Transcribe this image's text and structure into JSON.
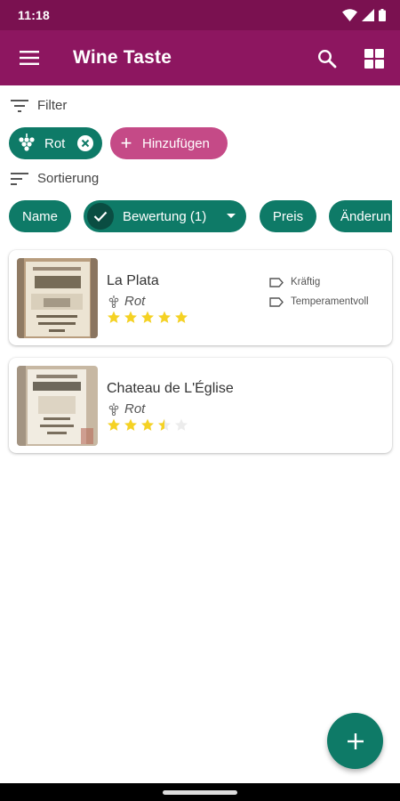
{
  "status_bar": {
    "time": "11:18"
  },
  "app_bar": {
    "title": "Wine Taste"
  },
  "filter": {
    "label": "Filter",
    "chips": [
      {
        "label": "Rot",
        "removable": true
      },
      {
        "label": "Hinzufügen"
      }
    ]
  },
  "sort": {
    "label": "Sortierung",
    "chips": [
      {
        "label": "Name"
      },
      {
        "label": "Bewertung (1)",
        "selected": true
      },
      {
        "label": "Preis"
      },
      {
        "label": "Änderun"
      }
    ]
  },
  "wines": [
    {
      "name": "La Plata",
      "type": "Rot",
      "rating": 5,
      "tags": [
        "Kräftig",
        "Temperamentvoll"
      ]
    },
    {
      "name": "Chateau de L'Église",
      "type": "Rot",
      "rating": 3.5,
      "tags": []
    }
  ],
  "colors": {
    "app_bar": "#8d1660",
    "status_bar": "#7a1150",
    "teal": "#0e7a67",
    "pink": "#c54a87",
    "star": "#f5d223"
  },
  "icons": {
    "menu": "menu-icon",
    "search": "search-icon",
    "grid": "grid-view-icon",
    "filter": "filter-icon",
    "sort": "sort-icon",
    "grapes": "grapes-icon",
    "close": "close-icon",
    "check": "check-icon",
    "tag": "tag-icon",
    "add": "add-icon"
  }
}
